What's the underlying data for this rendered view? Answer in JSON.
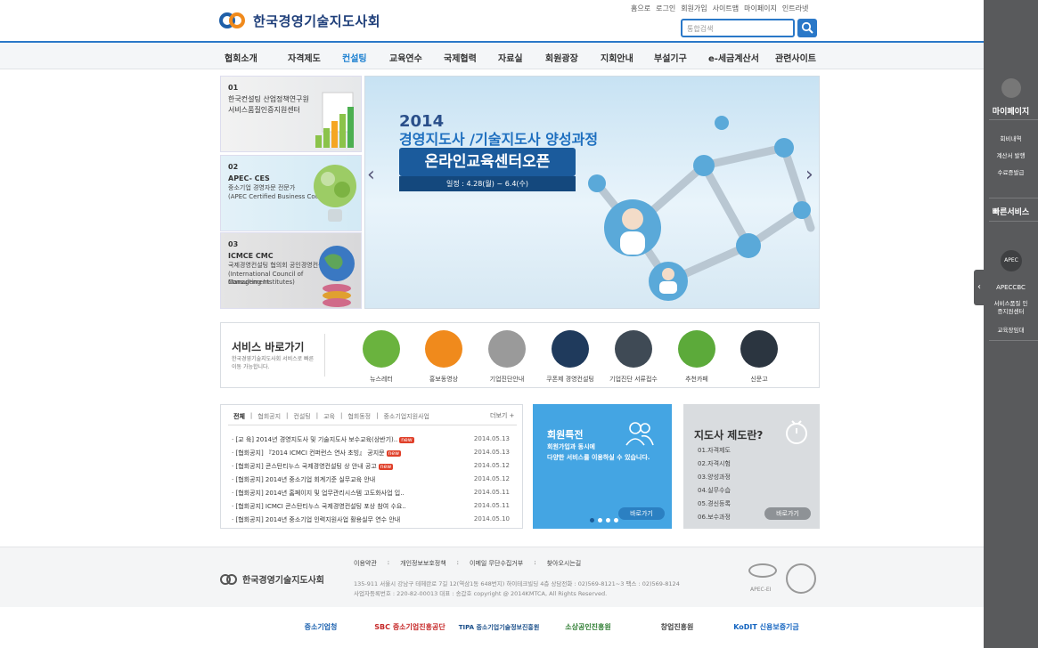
{
  "header": {
    "logo_text": "한국경영기술지도사회",
    "util_links": [
      "홈으로",
      "로그인",
      "회원가입",
      "사이트맵",
      "마이페이지",
      "인트라넷"
    ],
    "search_placeholder": "통합검색"
  },
  "nav": [
    "협회소개",
    "자격제도",
    "컨설팅",
    "교육연수",
    "국제협력",
    "자료실",
    "회원광장",
    "지회안내",
    "부설기구",
    "e-세금계산서",
    "관련사이트"
  ],
  "nav_active_color": "#1a7fd0",
  "features": [
    {
      "num": "01",
      "line1": "한국컨설팅 산업정책연구원",
      "line2": "서비스품질인증지원센터"
    },
    {
      "num": "02",
      "line1": "APEC- CES",
      "line2": "중소기업 경영자문 전문가",
      "line3": "(APEC Certified Business Counselor)"
    },
    {
      "num": "03",
      "line1": "ICMCE CMC",
      "line2": "국제경영컨설팅 협의회 공인경영컨설턴트",
      "line3": "(International Council of Management",
      "line4": "Consulting Institutes)"
    }
  ],
  "banner": {
    "year": "2014",
    "course": "경영지도사 /기술지도사 양성과정",
    "headline": "온라인교육센터오픈",
    "date": "일정 : 4.28(월) ~ 6.4(수)"
  },
  "quick": {
    "title": "서비스 바로가기",
    "desc": "한국경영기술지도사회 서비스로 빠른 이동 가능합니다.",
    "items": [
      {
        "label": "뉴스레터",
        "color": "#6ab33e"
      },
      {
        "label": "홍보동영상",
        "color": "#f08a1c"
      },
      {
        "label": "기업진단안내",
        "color": "#9a9a9a"
      },
      {
        "label": "쿠폰제 경영컨설팅",
        "color": "#1f3a5c"
      },
      {
        "label": "기업진단 서류접수",
        "color": "#3f4a55"
      },
      {
        "label": "추천카페",
        "color": "#5caa3a"
      },
      {
        "label": "신문고",
        "color": "#2b3540"
      }
    ]
  },
  "news": {
    "tabs": [
      "전체",
      "협회공지",
      "컨설팅",
      "교육",
      "협회동정",
      "중소기업지원사업"
    ],
    "more": "더보기 +",
    "rows": [
      {
        "title": "[교 육] 2014년 경영지도사 및 기술지도사 보수교육(상반기)..",
        "new": true,
        "date": "2014.05.13"
      },
      {
        "title": "[협회공지] 『2014 ICMCI 컨퍼런스 연사 초빙』 공지문",
        "new": true,
        "date": "2014.05.13"
      },
      {
        "title": "[협회공지] 콘스탄티누스 국제경영컨설팅 상 안내 공고",
        "new": true,
        "date": "2014.05.12"
      },
      {
        "title": "[협회공지] 2014년 중소기업 회계기준 실무교육 안내",
        "new": false,
        "date": "2014.05.12"
      },
      {
        "title": "[협회공지] 2014년 홈페이지 및 업무관리시스템 고도화사업 입..",
        "new": false,
        "date": "2014.05.11"
      },
      {
        "title": "[협회공지] ICMCI 콘스탄티누스 국제경영컨설팅 포상 참여 수요..",
        "new": false,
        "date": "2014.05.11"
      },
      {
        "title": "[협회공지] 2014년 중소기업 인력지원사업 활용실무 연수 안내",
        "new": false,
        "date": "2014.05.10"
      }
    ],
    "new_label": "new"
  },
  "member": {
    "title": "회원특전",
    "desc1": "회원가입과 동시에",
    "desc2": "다양한 서비스를 이용하실 수 있습니다.",
    "button": "바로가기"
  },
  "jidosa": {
    "title": "지도사 제도란?",
    "items": [
      "01.자격제도",
      "02.자격시험",
      "03.양성과정",
      "04.실무수습",
      "05.경신등록",
      "06.보수과정"
    ],
    "button": "바로가기"
  },
  "footer": {
    "links": [
      "이용약관",
      "개인정보보호정책",
      "이메일 무단수집거부",
      "찾아오시는길"
    ],
    "addr1": "135-911 서울시 강남구 테헤란로 7길 12(역삼1동 648번지) 하이테크빌딩 4층   상담전화 : 02)569-8121~3      팩스 : 02)569-8124",
    "addr2": "사업자등록번호 : 220-82-00013     대표 : 송갑호    copyright @ 2014KMTCA, All Rights Reserved.",
    "logo_text": "한국경영기술지도사회",
    "badge": "APEC-EI"
  },
  "partners": [
    "중소기업청",
    "SBC 중소기업진흥공단",
    "TIPA 중소기업기술정보진흥원",
    "소상공인진흥원",
    "창업진흥원",
    "KoDIT 신용보증기금"
  ],
  "side": {
    "mypage": "마이페이지",
    "links": [
      "회비내역",
      "계산서 발행",
      "수료증발급"
    ],
    "quick_title": "빠른서비스",
    "apec_icon": "APEC",
    "links2": [
      "APECCBC",
      "서비스품질 인증지원센터",
      "교육장임대"
    ]
  }
}
